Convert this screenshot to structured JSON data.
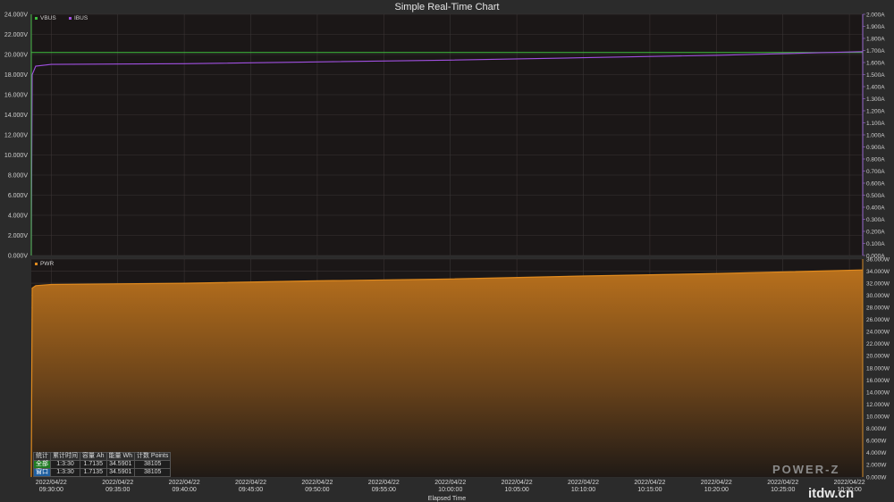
{
  "chart_data": [
    {
      "type": "line",
      "title": "Simple Real-Time Chart",
      "legend": [
        "VBUS",
        "IBUS"
      ],
      "legend_placement": "top-left",
      "x_ticks": [
        "2022/04/22\n09:30:00",
        "2022/04/22\n09:35:00",
        "2022/04/22\n09:40:00",
        "2022/04/22\n09:45:00",
        "2022/04/22\n09:50:00",
        "2022/04/22\n09:55:00",
        "2022/04/22\n10:00:00",
        "2022/04/22\n10:05:00",
        "2022/04/22\n10:10:00",
        "2022/04/22\n10:15:00",
        "2022/04/22\n10:20:00",
        "2022/04/22\n10:25:00",
        "2022/04/22\n10:30:00"
      ],
      "y_left": {
        "ylim": [
          0,
          24
        ],
        "ticks": [
          "0.000V",
          "2.000V",
          "4.000V",
          "6.000V",
          "8.000V",
          "10.000V",
          "12.000V",
          "14.000V",
          "16.000V",
          "18.000V",
          "20.000V",
          "22.000V",
          "24.000V"
        ]
      },
      "y_right": {
        "ylim": [
          0,
          2
        ],
        "ticks": [
          "0.000A",
          "0.100A",
          "0.200A",
          "0.300A",
          "0.400A",
          "0.500A",
          "0.600A",
          "0.700A",
          "0.800A",
          "0.900A",
          "1.000A",
          "1.100A",
          "1.200A",
          "1.300A",
          "1.400A",
          "1.500A",
          "1.600A",
          "1.700A",
          "1.800A",
          "1.900A",
          "2.000A"
        ]
      },
      "grid": true,
      "series": [
        {
          "name": "VBUS",
          "axis": "left",
          "color": "#3fbf3f",
          "x": [
            "09:28:30",
            "09:30:00",
            "10:00:00",
            "10:31:00"
          ],
          "y": [
            20.2,
            20.2,
            20.2,
            20.2
          ]
        },
        {
          "name": "IBUS",
          "axis": "right",
          "color": "#a050e0",
          "x": [
            "09:28:30",
            "09:28:34",
            "09:28:50",
            "09:30:00",
            "09:40:00",
            "09:50:00",
            "10:00:00",
            "10:10:00",
            "10:20:00",
            "10:31:00"
          ],
          "y": [
            0.0,
            1.5,
            1.57,
            1.585,
            1.59,
            1.605,
            1.62,
            1.64,
            1.66,
            1.69
          ]
        }
      ]
    },
    {
      "type": "area",
      "legend": [
        "PWR"
      ],
      "legend_placement": "top-left",
      "xlabel": "Elapsed Time",
      "y_right": {
        "ylim": [
          0,
          36
        ],
        "ticks": [
          "0.000W",
          "2.000W",
          "4.000W",
          "6.000W",
          "8.000W",
          "10.000W",
          "12.000W",
          "14.000W",
          "16.000W",
          "18.000W",
          "20.000W",
          "22.000W",
          "24.000W",
          "26.000W",
          "28.000W",
          "30.000W",
          "32.000W",
          "34.000W",
          "36.000W"
        ]
      },
      "grid": true,
      "series": [
        {
          "name": "PWR",
          "color": "#e08a1e",
          "x": [
            "09:28:30",
            "09:28:34",
            "09:28:50",
            "09:30:00",
            "09:40:00",
            "09:50:00",
            "10:00:00",
            "10:10:00",
            "10:20:00",
            "10:31:00"
          ],
          "y": [
            0.0,
            31.2,
            31.6,
            31.8,
            32.0,
            32.4,
            32.7,
            33.2,
            33.6,
            34.2
          ]
        }
      ]
    }
  ],
  "stats": {
    "headers": [
      "统计",
      "累计时间",
      "容量 Ah",
      "能量 Wh",
      "计数 Points"
    ],
    "rows": [
      {
        "label": "全部",
        "time": "1:3:30",
        "ah": "1.7135",
        "wh": "34.5901",
        "points": "38105"
      },
      {
        "label": "窗口",
        "time": "1:3:30",
        "ah": "1.7135",
        "wh": "34.5901",
        "points": "38105"
      }
    ]
  },
  "brand": "POWER-Z",
  "watermark": "itdw.cn"
}
